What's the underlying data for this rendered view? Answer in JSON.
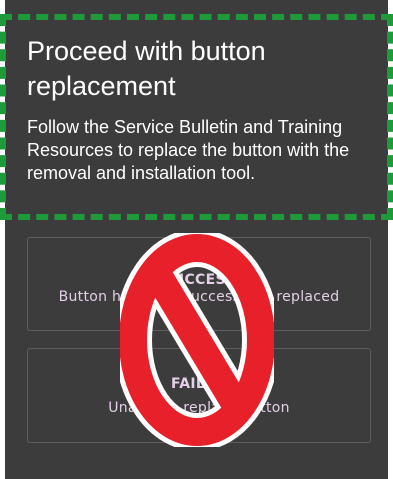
{
  "dialog": {
    "title": "Proceed with button replacement",
    "instructions": "Follow the Service Bulletin and Training Resources to replace the button with the removal and installation tool."
  },
  "options": [
    {
      "status": "SUCCESS",
      "description": "Button has been successfully replaced"
    },
    {
      "status": "FAILED",
      "description": "Unable to replace button"
    }
  ],
  "overlay": {
    "icon": "prohibited-icon",
    "color": "#e8202a"
  },
  "colors": {
    "panel_background": "#3c3c3c",
    "highlight_border": "#1e9a3a",
    "option_text": "#e3cfe6"
  }
}
